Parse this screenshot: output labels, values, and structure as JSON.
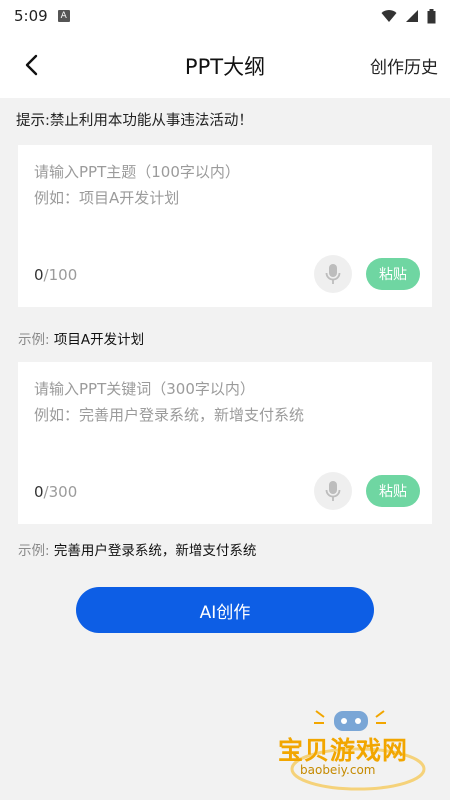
{
  "status_bar": {
    "time": "5:09",
    "app_icon_letter": "A",
    "icons": [
      "wifi-icon",
      "signal-icon",
      "battery-icon"
    ]
  },
  "nav": {
    "title": "PPT大纲",
    "history_label": "创作历史",
    "back_icon": "chevron-left-icon"
  },
  "notice": "提示:禁止利用本功能从事违法活动！",
  "topic_card": {
    "placeholder": "请输入PPT主题（100字以内）\n例如：项目A开发计划",
    "value": "",
    "count": "0",
    "max": "/100",
    "mic_icon": "microphone-icon",
    "paste_label": "粘贴"
  },
  "topic_example": {
    "label": "示例:",
    "text": "项目A开发计划"
  },
  "keyword_card": {
    "placeholder": "请输入PPT关键词（300字以内）\n例如：完善用户登录系统，新增支付系统",
    "value": "",
    "count": "0",
    "max": "/300",
    "mic_icon": "microphone-icon",
    "paste_label": "粘贴"
  },
  "keyword_example": {
    "label": "示例:",
    "text": "完善用户登录系统，新增支付系统"
  },
  "ai_button_label": "AI创作",
  "watermark": {
    "text": "宝贝游戏网",
    "url": "baobeiy.com"
  },
  "colors": {
    "primary": "#0d5ee5",
    "paste_green": "#6fd6a2",
    "background": "#f2f2f2",
    "watermark": "#f2a600"
  }
}
